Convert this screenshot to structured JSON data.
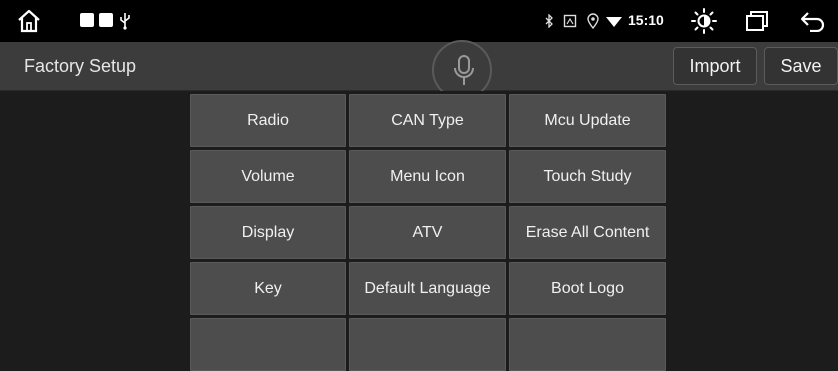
{
  "status_bar": {
    "time": "15:10",
    "icons": [
      "home-icon",
      "app-square-icon",
      "app-square-icon",
      "usb-icon",
      "bluetooth-icon",
      "sim-card-icon",
      "location-pin-icon",
      "wifi-icon",
      "brightness-icon",
      "recent-apps-icon",
      "back-arrow-icon"
    ]
  },
  "header": {
    "title": "Factory Setup",
    "import_label": "Import",
    "save_label": "Save",
    "mic_icon": "microphone-icon"
  },
  "menu": {
    "items": [
      {
        "label": "Radio"
      },
      {
        "label": "CAN Type"
      },
      {
        "label": "Mcu Update"
      },
      {
        "label": "Volume"
      },
      {
        "label": "Menu Icon"
      },
      {
        "label": "Touch Study"
      },
      {
        "label": "Display"
      },
      {
        "label": "ATV"
      },
      {
        "label": "Erase All Content"
      },
      {
        "label": "Key"
      },
      {
        "label": "Default Language"
      },
      {
        "label": "Boot Logo"
      }
    ]
  },
  "colors": {
    "status_bar_bg": "#000000",
    "title_bar_bg": "#3c3c3c",
    "cell_bg": "#4d4d4d",
    "page_bg": "#1c1c1c"
  }
}
